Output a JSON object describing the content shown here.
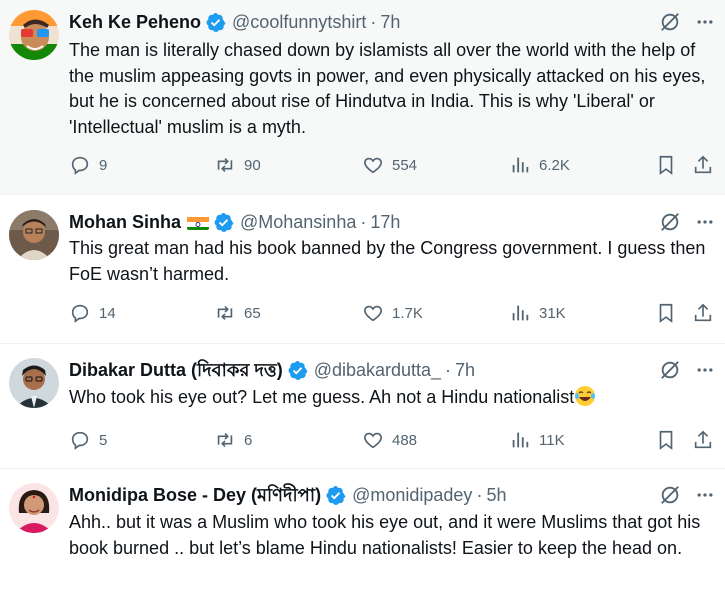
{
  "tweets": [
    {
      "display_name": "Keh Ke Peheno",
      "handle": "@coolfunnytshirt",
      "separator": "·",
      "time": "7h",
      "text": "The man is literally chased down by islamists all over the world with the help of the muslim appeasing govts in power, and even physically attacked on his eyes, but he is concerned about rise of Hindutva in India. This is why 'Liberal' or 'Intellectual' muslim is a myth.",
      "replies": "9",
      "reposts": "90",
      "likes": "554",
      "views": "6.2K"
    },
    {
      "display_name": "Mohan Sinha",
      "flag": "india-flag",
      "handle": "@Mohansinha",
      "separator": "·",
      "time": "17h",
      "text": "This great man had his book banned by the Congress government. I guess then FoE wasn’t harmed.",
      "replies": "14",
      "reposts": "65",
      "likes": "1.7K",
      "views": "31K"
    },
    {
      "display_name": "Dibakar Dutta (দিবাকর দত্ত)",
      "handle": "@dibakardutta_",
      "separator": "·",
      "time": "7h",
      "text": "Who took his eye out? Let me guess. Ah not a Hindu nationalist",
      "text_emoji": "face-with-tears-of-joy",
      "replies": "5",
      "reposts": "6",
      "likes": "488",
      "views": "11K"
    },
    {
      "display_name": "Monidipa Bose - Dey (মণিদীপা)",
      "handle": "@monidipadey",
      "separator": "·",
      "time": "5h",
      "text": "Ahh.. but it was a Muslim who took his eye out, and it were Muslims that got his book burned .. but let’s blame Hindu nationalists! Easier to keep the head on."
    }
  ],
  "colors": {
    "text": "#0f1419",
    "secondary": "#536471",
    "verified": "#1d9bf0",
    "highlight_bg": "#f7f9f9",
    "divider": "#eff3f4"
  }
}
